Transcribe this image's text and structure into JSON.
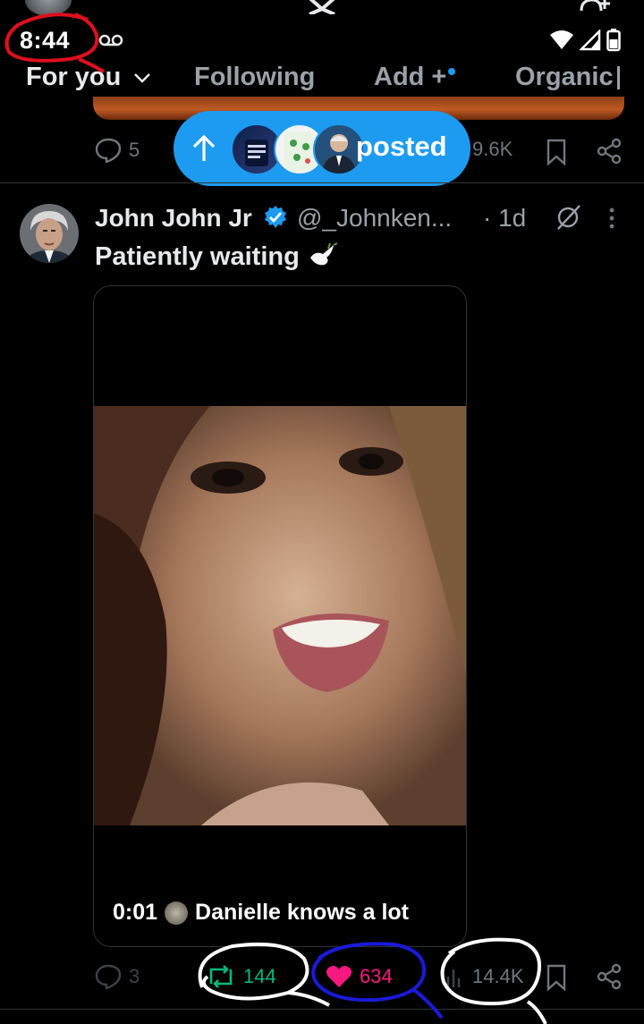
{
  "status_bar": {
    "time": "8:44"
  },
  "tabs": [
    {
      "label": "For you",
      "active": true
    },
    {
      "label": "Following",
      "active": false
    },
    {
      "label": "Add +",
      "active": false
    },
    {
      "label": "Organic",
      "active": false
    }
  ],
  "prev_tweet": {
    "replies": "5",
    "views": "9.6K"
  },
  "new_posts_pill": {
    "label": "posted"
  },
  "tweet": {
    "author_name": "John John Jr",
    "author_handle": "@_Johnken...",
    "time": "· 1d",
    "text": "Patiently waiting",
    "video_time": "0:01",
    "video_caption": "Danielle knows a lot",
    "replies": "3",
    "reposts": "144",
    "likes": "634",
    "views": "14.4K"
  },
  "colors": {
    "accent_blue": "#1d9bf0",
    "repost_green": "#00ba7c",
    "like_pink": "#f91880",
    "annotation_red": "#e0101f",
    "annotation_blue": "#1a1ad8",
    "annotation_white": "#ffffff"
  },
  "icons": [
    "voicemail-icon",
    "x-logo-icon",
    "add-user-icon",
    "wifi-icon",
    "signal-icon",
    "battery-icon",
    "chevron-down-icon",
    "reply-icon",
    "bookmark-icon",
    "share-icon",
    "arrow-up-icon",
    "verified-badge-icon",
    "grok-icon",
    "more-icon",
    "repost-icon",
    "heart-icon",
    "views-icon",
    "dove-emoji-icon"
  ]
}
